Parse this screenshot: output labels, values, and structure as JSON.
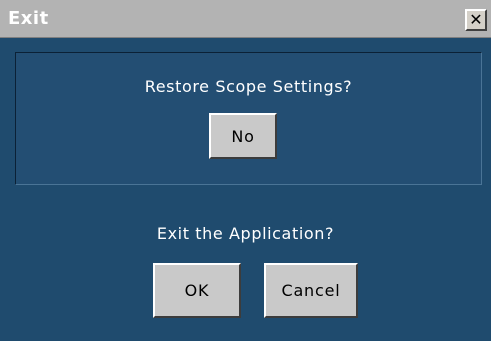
{
  "window": {
    "title": "Exit",
    "close_glyph": "✕"
  },
  "restore": {
    "prompt": "Restore Scope Settings?",
    "no_label": "No"
  },
  "exit": {
    "prompt": "Exit the Application?",
    "ok_label": "OK",
    "cancel_label": "Cancel"
  },
  "colors": {
    "dialog_bg": "#1f4b6e",
    "titlebar_bg": "#b3b3b3",
    "button_bg": "#c9c9c9"
  }
}
